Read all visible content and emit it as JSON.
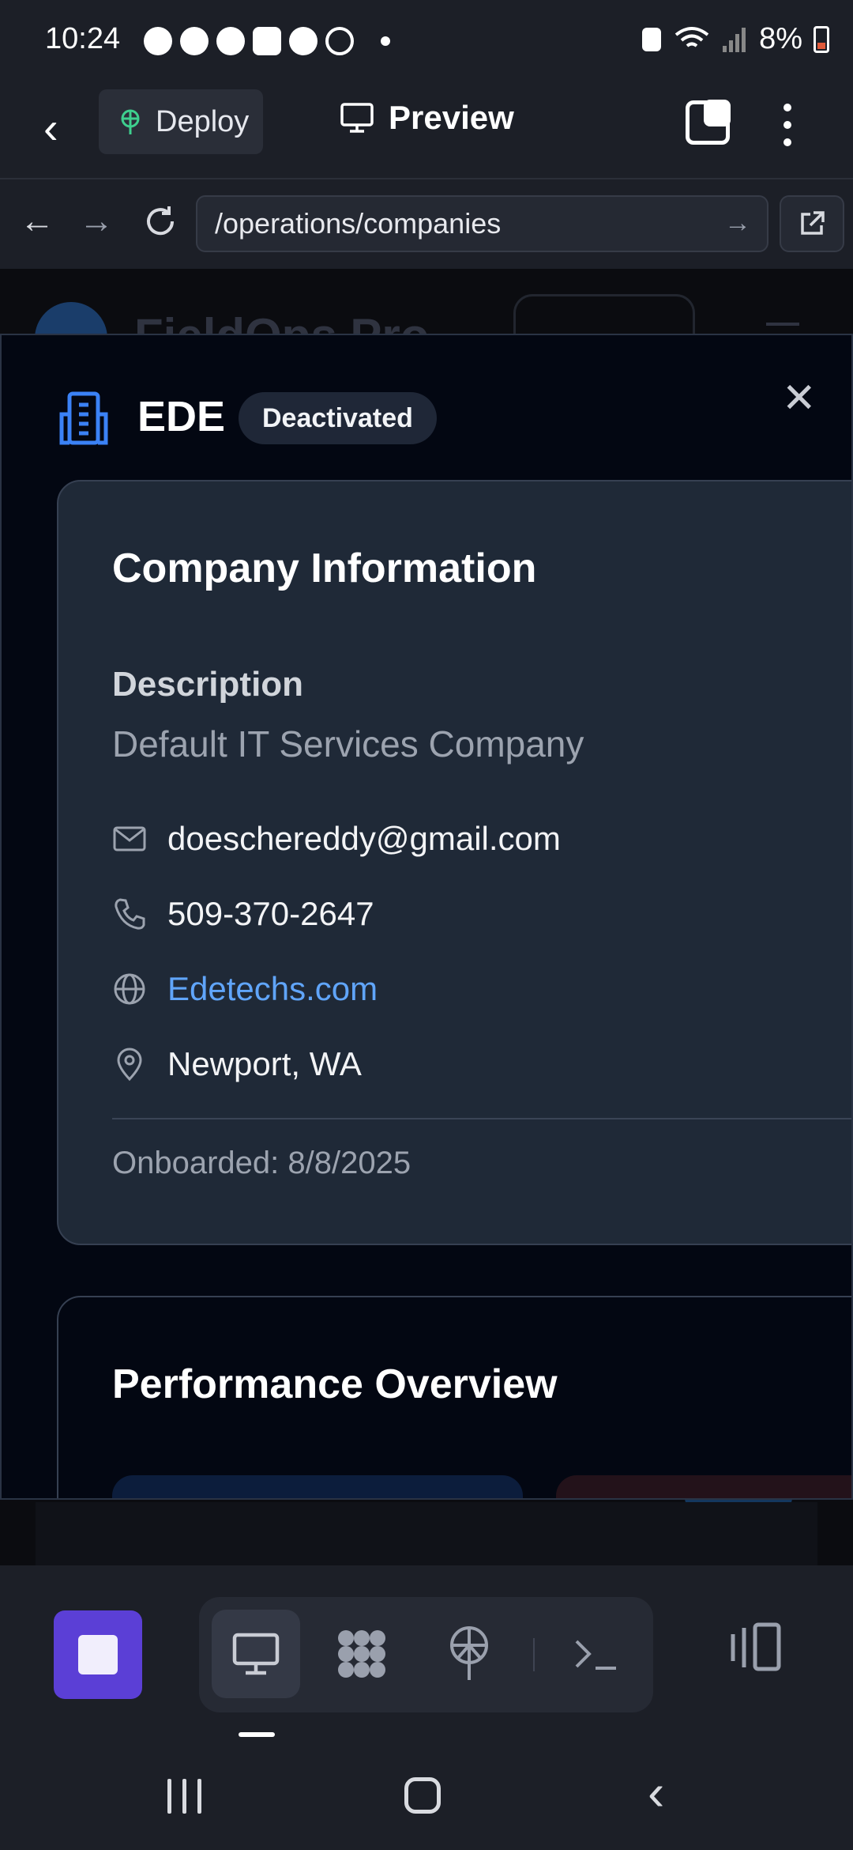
{
  "status_bar": {
    "time": "10:24",
    "battery": "8%",
    "notification_icons": [
      "messenger-icon",
      "messenger-icon",
      "messenger-icon",
      "alert-icon",
      "messenger-icon",
      "missed-call-icon"
    ]
  },
  "app_bar": {
    "deploy_label": "Deploy",
    "preview_label": "Preview"
  },
  "browser": {
    "url": "/operations/companies"
  },
  "background_page": {
    "brand": "FieldOps Pro"
  },
  "modal": {
    "company_name": "EDE",
    "status_badge": "Deactivated",
    "info_card": {
      "title": "Company Information",
      "description_label": "Description",
      "description_value": "Default IT Services Company",
      "email": "doeschereddy@gmail.com",
      "phone": "509-370-2647",
      "website": "Edetechs.com",
      "location": "Newport, WA",
      "onboarded": "Onboarded: 8/8/2025"
    },
    "performance_card": {
      "title": "Performance Overview"
    }
  },
  "colors": {
    "accent_purple": "#5b3fd6",
    "link_blue": "#60a5fa",
    "card_bg": "#1f2937",
    "modal_bg": "#030712"
  }
}
